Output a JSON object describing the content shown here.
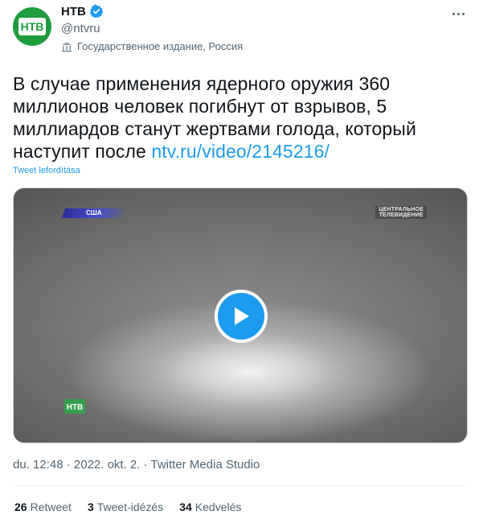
{
  "author": {
    "display_name": "НТВ",
    "handle": "@ntvru",
    "verified_icon": "verified-badge-icon",
    "label": "Государственное издание, Россия",
    "label_icon": "gov-building-icon",
    "avatar_icon": "ntv-logo-icon"
  },
  "tweet": {
    "text": "В случае применения ядерного оружия 360 миллионов человек погибнут от взрывов, 5 миллиардов станут жертвами голода, который наступит после ",
    "link": "ntv.ru/video/2145216/",
    "translate": "Tweet lefordítása"
  },
  "video": {
    "country_tag": "США",
    "channel_logo_line1": "ЦЕНТРАЛЬНОЕ",
    "channel_logo_line2": "ТЕЛЕВИДЕНИЕ",
    "play_icon": "play-icon"
  },
  "meta": {
    "timestamp": "du. 12:48 · 2022. okt. 2. · Twitter Media Studio"
  },
  "stats": {
    "retweets_count": "26",
    "retweets_label": "Retweet",
    "quotes_count": "3",
    "quotes_label": "Tweet-idézés",
    "likes_count": "34",
    "likes_label": "Kedvelés"
  },
  "colors": {
    "accent": "#1d9bf0",
    "brand_green": "#1e9c3e",
    "text_primary": "#0f1419",
    "text_secondary": "#536471"
  }
}
